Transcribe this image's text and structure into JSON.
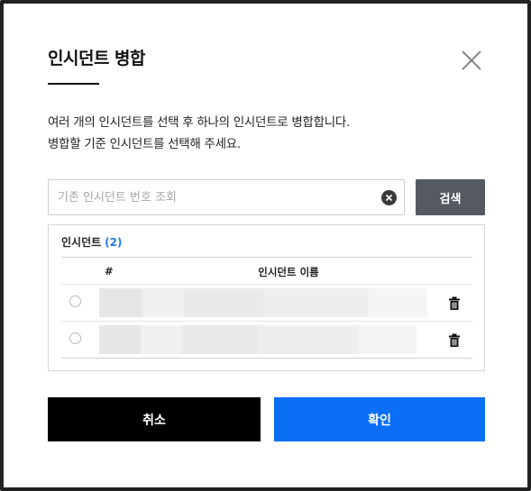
{
  "dialog": {
    "title": "인시던트 병합",
    "close_icon": "close-icon",
    "description_line1": "여러 개의 인시던트를 선택 후 하나의 인시던트로 병합합니다.",
    "description_line2": "병합할 기준 인시던트를 선택해 주세요."
  },
  "search": {
    "placeholder": "기존 인시던트 번호 조회",
    "value": "",
    "clear_icon": "clear-circle-icon",
    "button_label": "검색"
  },
  "incident_list": {
    "title": "인시던트",
    "count": "(2)",
    "columns": [
      "#",
      "인시던트 이름"
    ],
    "rows": [
      {
        "selected": false,
        "name": "",
        "delete_icon": "trash-icon"
      },
      {
        "selected": false,
        "name": "",
        "delete_icon": "trash-icon"
      }
    ]
  },
  "footer": {
    "cancel_label": "취소",
    "confirm_label": "확인"
  },
  "colors": {
    "confirm": "#0a6ff5",
    "cancel": "#000000",
    "search_button": "#555a61",
    "count_accent": "#1e7be8"
  }
}
